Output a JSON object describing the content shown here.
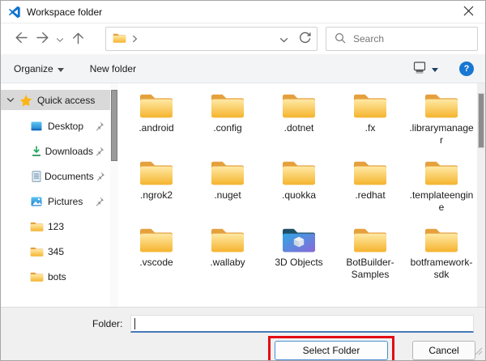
{
  "window": {
    "title": "Workspace folder"
  },
  "navbar": {
    "search_placeholder": "Search"
  },
  "toolbar": {
    "organize_label": "Organize",
    "new_folder_label": "New folder",
    "help_label": "?"
  },
  "sidebar": {
    "items": [
      {
        "label": "Quick access",
        "icon": "star",
        "selected": true,
        "expanded": true,
        "pinned": false
      },
      {
        "label": "Desktop",
        "icon": "desktop",
        "pinned": true
      },
      {
        "label": "Downloads",
        "icon": "download",
        "pinned": true
      },
      {
        "label": "Documents",
        "icon": "document",
        "pinned": true
      },
      {
        "label": "Pictures",
        "icon": "pictures",
        "pinned": true
      },
      {
        "label": "123",
        "icon": "folder",
        "pinned": false
      },
      {
        "label": "345",
        "icon": "folder",
        "pinned": false
      },
      {
        "label": "bots",
        "icon": "folder",
        "pinned": false
      }
    ]
  },
  "main": {
    "folders": [
      {
        "name": ".android",
        "icon": "folder"
      },
      {
        "name": ".config",
        "icon": "folder"
      },
      {
        "name": ".dotnet",
        "icon": "folder"
      },
      {
        "name": ".fx",
        "icon": "folder"
      },
      {
        "name": ".librarymanager",
        "icon": "folder"
      },
      {
        "name": ".ngrok2",
        "icon": "folder"
      },
      {
        "name": ".nuget",
        "icon": "folder"
      },
      {
        "name": ".quokka",
        "icon": "folder"
      },
      {
        "name": ".redhat",
        "icon": "folder"
      },
      {
        "name": ".templateengine",
        "icon": "folder"
      },
      {
        "name": ".vscode",
        "icon": "folder"
      },
      {
        "name": ".wallaby",
        "icon": "folder"
      },
      {
        "name": "3D Objects",
        "icon": "folder-3d"
      },
      {
        "name": "BotBuilder-Samples",
        "icon": "folder"
      },
      {
        "name": "botframework-sdk",
        "icon": "folder"
      }
    ]
  },
  "footer": {
    "folder_label": "Folder:",
    "folder_value": "",
    "select_button": "Select Folder",
    "cancel_button": "Cancel"
  },
  "colors": {
    "accent_blue": "#4678b8",
    "select_border_blue": "#4a8fd3",
    "annotation_red": "#e40b12",
    "help_blue": "#1877d2",
    "folder_gold": "#f5b42e",
    "folder_tab": "#e5a03c",
    "folder3d_blue": "#2fa7e4",
    "folder3d_purple": "#8a68d9",
    "selected_gray": "#d9d9d9",
    "toolbar_bg": "#f3f4f6",
    "footer_bg": "#f0f0f0"
  }
}
